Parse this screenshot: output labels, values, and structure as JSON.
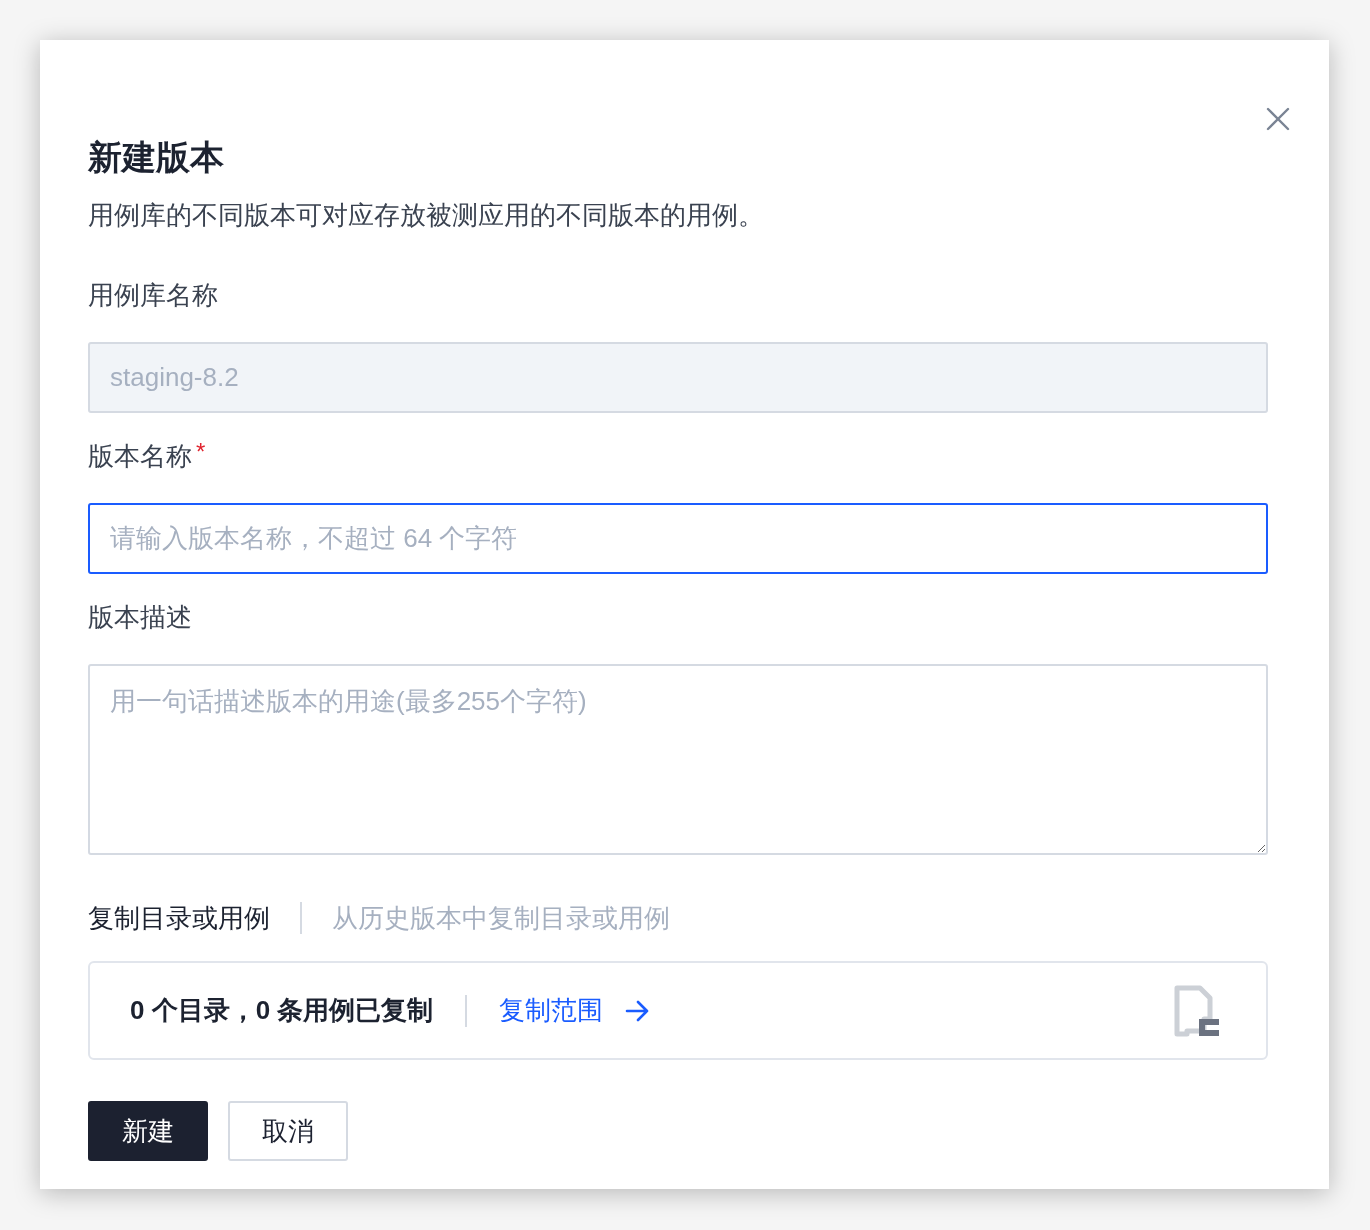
{
  "dialog": {
    "title": "新建版本",
    "description": "用例库的不同版本可对应存放被测应用的不同版本的用例。"
  },
  "fields": [
    {
      "kind": "input",
      "label": "用例库名称",
      "value": "staging-8.2",
      "disabled": true,
      "focused": false
    },
    {
      "kind": "input",
      "label": "版本名称",
      "required_mark": "*",
      "placeholder": "请输入版本名称，不超过 64 个字符",
      "disabled": false,
      "focused": true
    },
    {
      "kind": "textarea",
      "label": "版本描述",
      "placeholder": "用一句话描述版本的用途(最多255个字符)",
      "disabled": false,
      "focused": false
    }
  ],
  "copy_section": {
    "label": "复制目录或用例",
    "hint": "从历史版本中复制目录或用例",
    "summary": "0 个目录，0 条用例已复制",
    "link": "复制范围"
  },
  "buttons": [
    {
      "kind": "primary",
      "label": "新建"
    },
    {
      "kind": "secondary",
      "label": "取消"
    }
  ]
}
